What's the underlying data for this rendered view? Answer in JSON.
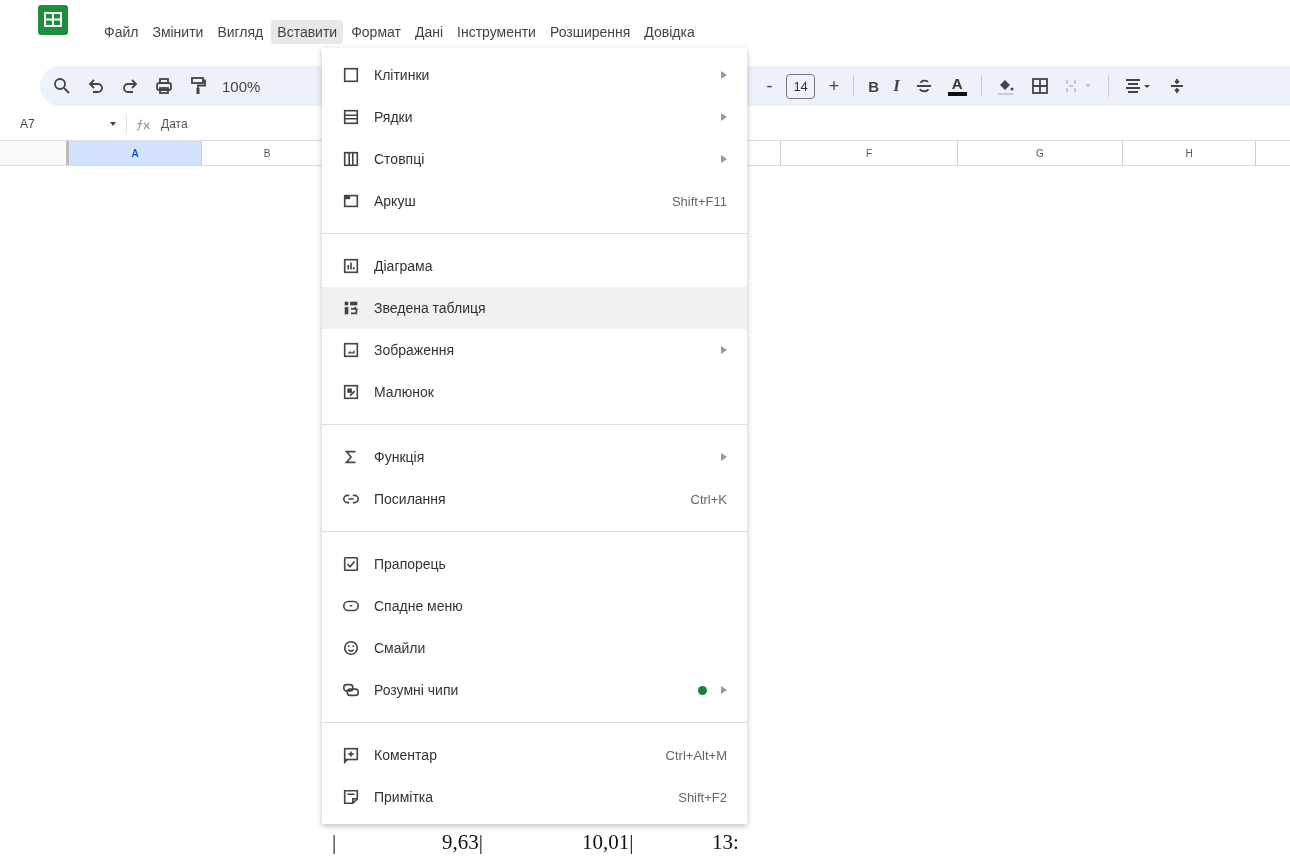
{
  "menubar": {
    "items": [
      {
        "label": "Файл",
        "selected": false
      },
      {
        "label": "Змінити",
        "selected": false
      },
      {
        "label": "Вигляд",
        "selected": false
      },
      {
        "label": "Вставити",
        "selected": true
      },
      {
        "label": "Формат",
        "selected": false
      },
      {
        "label": "Дані",
        "selected": false
      },
      {
        "label": "Інструменти",
        "selected": false
      },
      {
        "label": "Розширення",
        "selected": false
      },
      {
        "label": "Довідка",
        "selected": false
      }
    ]
  },
  "toolbar": {
    "zoom": "100%",
    "font_size_minus": "-",
    "font_size": "14",
    "font_size_plus": "+",
    "bold": "B",
    "italic": "I",
    "text_color": "A"
  },
  "formula_bar": {
    "cell_ref": "A7",
    "formula": "Дата"
  },
  "columns": [
    {
      "label": "A",
      "selected": true
    },
    {
      "label": "B",
      "selected": false
    },
    {
      "label": "F",
      "selected": false
    },
    {
      "label": "G",
      "selected": false
    },
    {
      "label": "H",
      "selected": false
    }
  ],
  "insert_menu": {
    "items": [
      {
        "kind": "item",
        "label": "Клітинки",
        "submenu": true,
        "selected": false
      },
      {
        "kind": "item",
        "label": "Рядки",
        "submenu": true,
        "selected": false
      },
      {
        "kind": "item",
        "label": "Стовпці",
        "submenu": true,
        "selected": false
      },
      {
        "kind": "item",
        "label": "Аркуш",
        "shortcut": "Shift+F11",
        "selected": false
      },
      {
        "kind": "separator"
      },
      {
        "kind": "item",
        "label": "Діаграма",
        "selected": false
      },
      {
        "kind": "item",
        "label": "Зведена таблиця",
        "selected": true
      },
      {
        "kind": "item",
        "label": "Зображення",
        "submenu": true,
        "selected": false
      },
      {
        "kind": "item",
        "label": "Малюнок",
        "selected": false
      },
      {
        "kind": "separator"
      },
      {
        "kind": "item",
        "label": "Функція",
        "submenu": true,
        "selected": false
      },
      {
        "kind": "item",
        "label": "Посилання",
        "shortcut": "Ctrl+K",
        "selected": false
      },
      {
        "kind": "separator"
      },
      {
        "kind": "item",
        "label": "Прапорець",
        "selected": false
      },
      {
        "kind": "item",
        "label": "Спадне меню",
        "selected": false
      },
      {
        "kind": "item",
        "label": "Смайли",
        "selected": false
      },
      {
        "kind": "item",
        "label": "Розумні чипи",
        "submenu": true,
        "dot": true,
        "selected": false
      },
      {
        "kind": "separator"
      },
      {
        "kind": "item",
        "label": "Коментар",
        "shortcut": "Ctrl+Alt+M",
        "selected": false
      },
      {
        "kind": "item",
        "label": "Примітка",
        "shortcut": "Shift+F2",
        "selected": false
      }
    ]
  },
  "footer_fragment": [
    "|",
    "9,63|",
    "10,01|",
    "13:"
  ]
}
